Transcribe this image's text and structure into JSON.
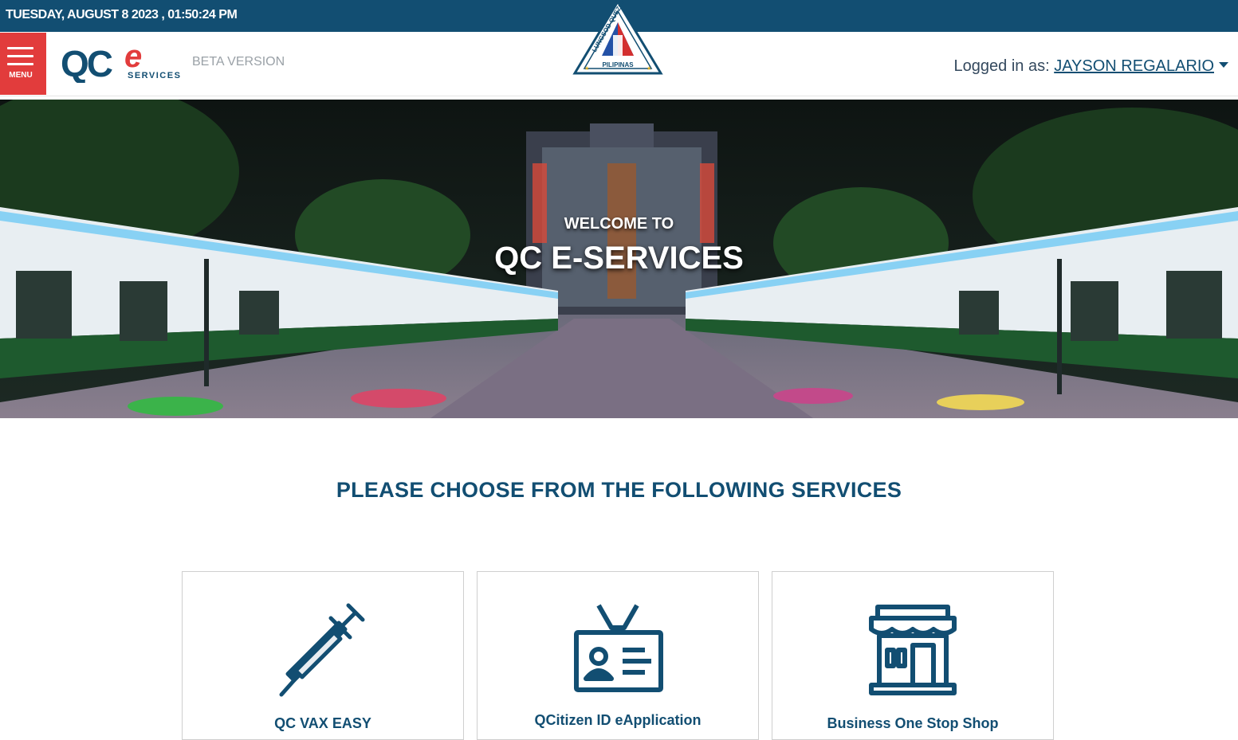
{
  "topbar": {
    "datetime": "TUESDAY, AUGUST 8 2023 , 01:50:24 PM"
  },
  "header": {
    "menu_label": "MENU",
    "logo_text": "QC",
    "logo_e": "e",
    "logo_sub": "SERVICES",
    "beta_label": "BETA VERSION",
    "seal_text_top": "LUNGSOD QUEZON",
    "seal_text_bottom": "PILIPINAS",
    "logged_in_prefix": "Logged in as: ",
    "user_name": "JAYSON REGALARIO"
  },
  "hero": {
    "welcome": "WELCOME TO",
    "title": "QC E-SERVICES"
  },
  "services": {
    "heading": "PLEASE CHOOSE FROM THE FOLLOWING SERVICES",
    "items": [
      {
        "label": "QC VAX EASY",
        "icon": "syringe-icon"
      },
      {
        "label": "QCitizen ID eApplication",
        "icon": "id-card-icon"
      },
      {
        "label": "Business One Stop Shop",
        "icon": "storefront-icon"
      }
    ]
  },
  "colors": {
    "brand_blue": "#124e72",
    "brand_red": "#e23c3c"
  }
}
